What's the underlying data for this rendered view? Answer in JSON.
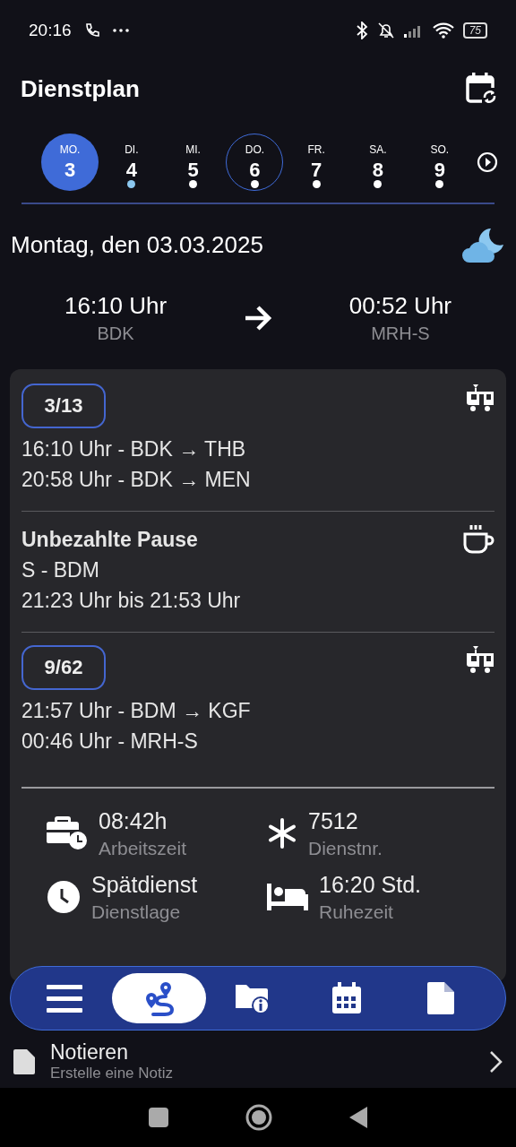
{
  "status_bar": {
    "time": "20:16",
    "battery": "75"
  },
  "header": {
    "title": "Dienstplan"
  },
  "week": [
    {
      "weekday": "MO.",
      "day": "3",
      "selected": true,
      "today": false
    },
    {
      "weekday": "DI.",
      "day": "4",
      "selected": false,
      "today": false,
      "color": "#8cc8f0"
    },
    {
      "weekday": "MI.",
      "day": "5",
      "selected": false,
      "today": false,
      "color": "#ffffff"
    },
    {
      "weekday": "DO.",
      "day": "6",
      "selected": false,
      "today": true,
      "color": "#ffffff"
    },
    {
      "weekday": "FR.",
      "day": "7",
      "selected": false,
      "today": false,
      "color": "#ffffff"
    },
    {
      "weekday": "SA.",
      "day": "8",
      "selected": false,
      "today": false,
      "color": "#ffffff"
    },
    {
      "weekday": "SO.",
      "day": "9",
      "selected": false,
      "today": false,
      "color": "#ffffff"
    }
  ],
  "day": {
    "date": "Montag, den 03.03.2025",
    "start_time": "16:10 Uhr",
    "start_place": "BDK",
    "end_time": "00:52 Uhr",
    "end_place": "MRH-S"
  },
  "segments": [
    {
      "kind": "trip",
      "badge": "3/13",
      "lines": [
        "16:10 Uhr - BDK → THB",
        "20:58 Uhr - BDK → MEN"
      ]
    },
    {
      "kind": "break",
      "title": "Unbezahlte Pause",
      "lines": [
        "S - BDM",
        "21:23 Uhr bis 21:53 Uhr"
      ]
    },
    {
      "kind": "trip",
      "badge": "9/62",
      "lines": [
        "21:57 Uhr - BDM → KGF",
        "00:46 Uhr - MRH-S"
      ]
    }
  ],
  "summary": [
    {
      "kind": "worktime",
      "value": "08:42h",
      "label": "Arbeitszeit"
    },
    {
      "kind": "number",
      "value": "7512",
      "label": "Dienstnr."
    },
    {
      "kind": "shift",
      "value": "Spätdienst",
      "label": "Dienstlage"
    },
    {
      "kind": "rest",
      "value": "16:20 Std.",
      "label": "Ruhezeit"
    }
  ],
  "bottom_nav": [
    {
      "kind": "menu",
      "selected": false
    },
    {
      "kind": "route",
      "selected": true
    },
    {
      "kind": "folder",
      "selected": false
    },
    {
      "kind": "calendar",
      "selected": false
    },
    {
      "kind": "document",
      "selected": false
    }
  ],
  "note": {
    "title": "Notieren",
    "subtitle": "Erstelle eine Notiz"
  }
}
